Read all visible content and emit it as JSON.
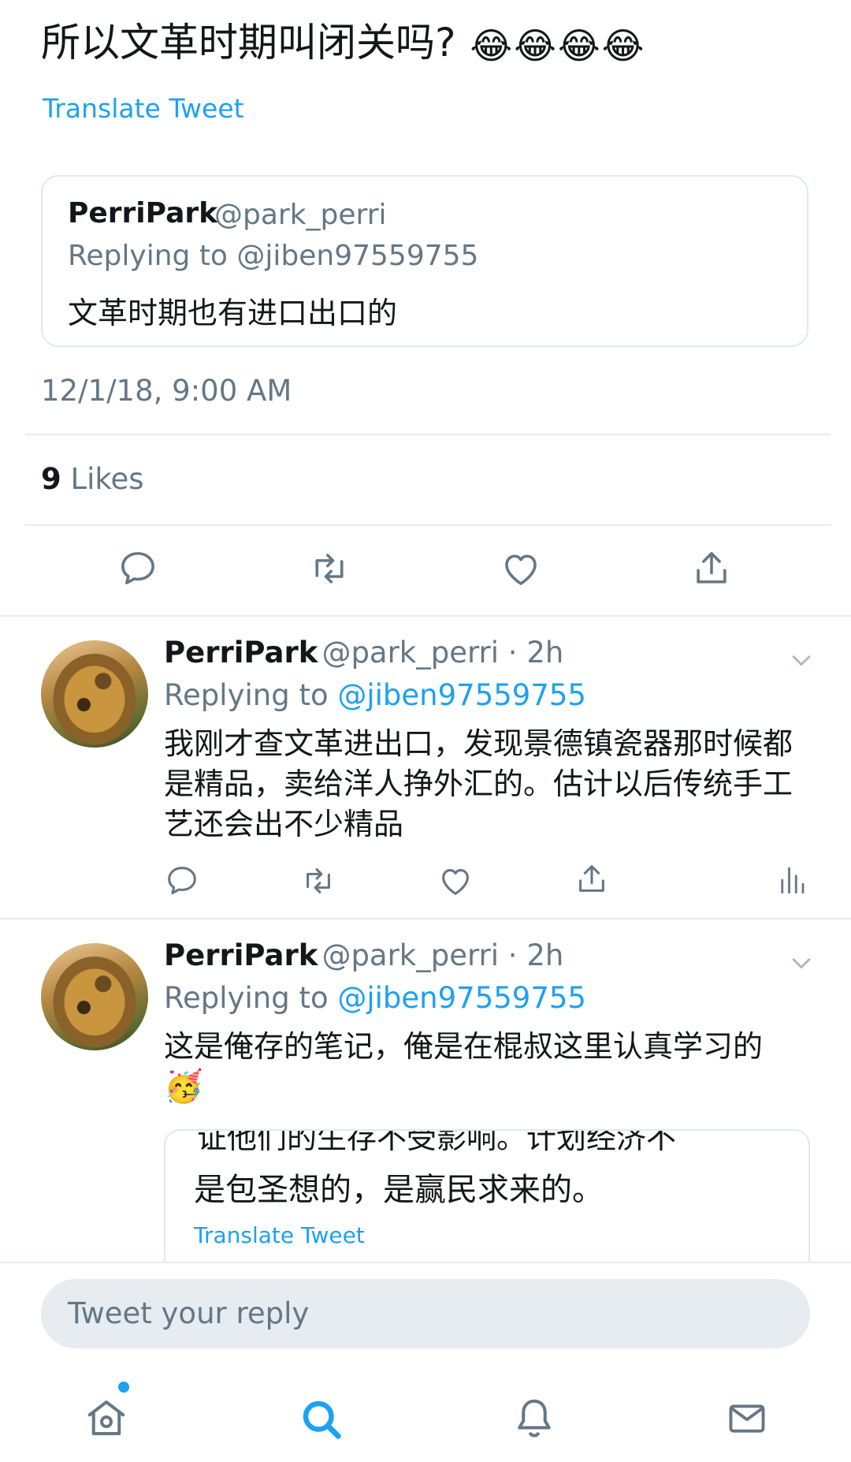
{
  "tweet": {
    "text": "所以文革时期叫闭关吗?",
    "emojis": [
      "😂",
      "😂",
      "😂",
      "😂"
    ],
    "translate_label": "Translate Tweet",
    "quoted": {
      "name": "PerriPark",
      "handle": "@park_perri",
      "replying": "Replying to @jiben97559755",
      "text": "文革时期也有进口出口的"
    },
    "timestamp": "12/1/18, 9:00 AM",
    "likes_count": "9",
    "likes_label": "Likes"
  },
  "actions": [
    "reply-icon",
    "retweet-icon",
    "like-icon",
    "share-icon"
  ],
  "replies": [
    {
      "name": "PerriPark",
      "handle": "@park_perri",
      "time": "2h",
      "replying_prefix": "Replying to",
      "replying_handle": "@jiben97559755",
      "text": "我刚才查文革进出口，发现景德镇瓷器那时候都是精品，卖给洋人挣外汇的。估计以后传统手工艺还会出不少精品"
    },
    {
      "name": "PerriPark",
      "handle": "@park_perri",
      "time": "2h",
      "replying_prefix": "Replying to",
      "replying_handle": "@jiben97559755",
      "text": "这是俺存的笔记，俺是在棍叔这里认真学习的",
      "emoji": "🥳",
      "embedded": {
        "cut_text": "证他们的生存不受影响。计划经济不",
        "text": "是包圣想的，是赢民求来的。",
        "translate_label": "Translate Tweet"
      }
    }
  ],
  "reply_input": {
    "placeholder": "Tweet your reply"
  },
  "tabbar": [
    "home-icon",
    "search-icon",
    "notifications-icon",
    "messages-icon"
  ],
  "colors": {
    "accent": "#1da1f2",
    "muted": "#657786",
    "text": "#14171a",
    "border": "#e6ecf0"
  }
}
